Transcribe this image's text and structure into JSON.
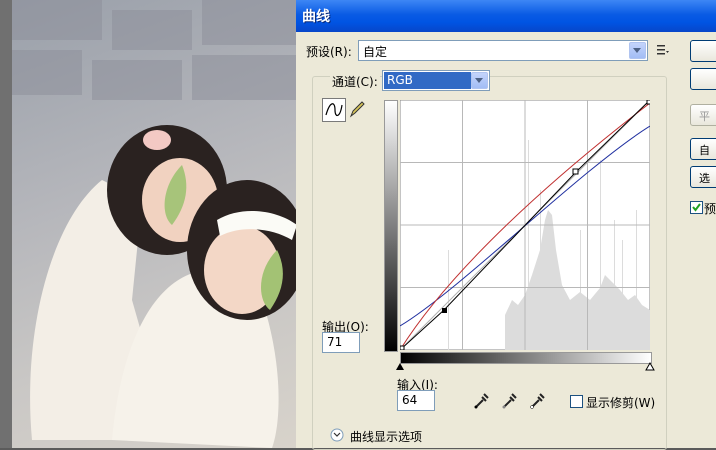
{
  "dialog": {
    "title": "曲线"
  },
  "preset": {
    "label": "预设(R):",
    "value": "自定"
  },
  "channel": {
    "label": "通道(C):",
    "value": "RGB"
  },
  "output": {
    "label": "输出(O):",
    "value": "71"
  },
  "input": {
    "label": "输入(I):",
    "value": "64"
  },
  "show_clipping": {
    "label": "显示修剪(W)",
    "checked": false
  },
  "curve_options": {
    "label": "曲线显示选项"
  },
  "side_buttons": {
    "b3": "平",
    "b4": "自",
    "b5": "选",
    "preview": "预"
  },
  "icons": {
    "preset_menu": "preset-menu-icon",
    "curve_tool": "curve-tool-icon",
    "pencil_tool": "pencil-icon",
    "black_eyedropper": "eyedropper-icon",
    "gray_eyedropper": "eyedropper-icon",
    "white_eyedropper": "eyedropper-icon",
    "expand": "chevron-down-icon"
  },
  "colors": {
    "titlebar": "#0054e3",
    "selected": "#316ac5",
    "curve": "#000000",
    "red_curve": "#c03030",
    "blue_curve": "#2030a0"
  }
}
